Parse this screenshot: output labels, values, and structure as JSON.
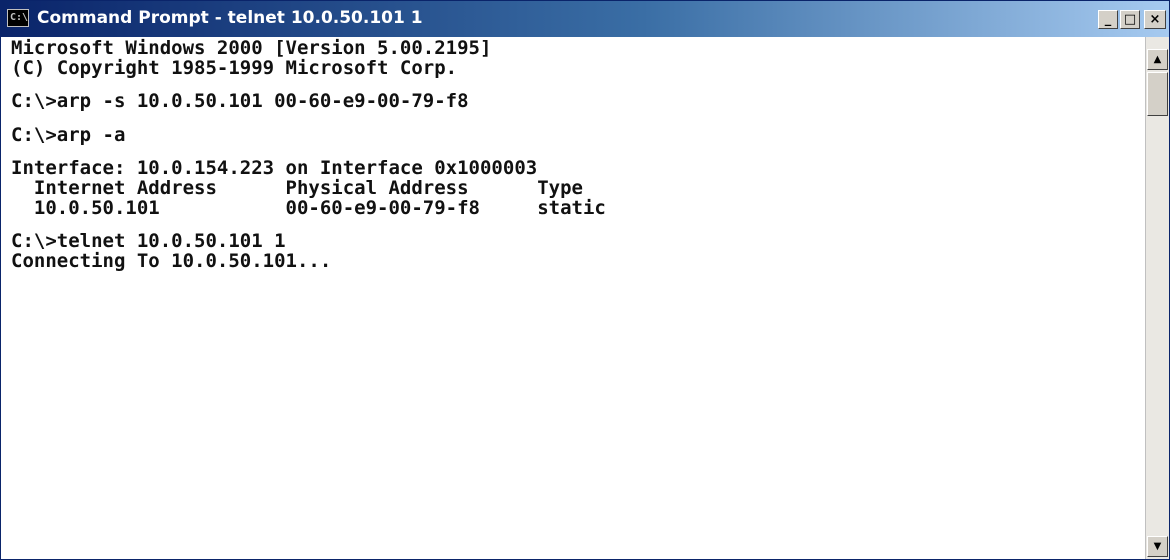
{
  "window": {
    "title": "Command Prompt - telnet 10.0.50.101 1",
    "icon": "console-app-icon",
    "icon_glyph": "C:\\",
    "controls": {
      "minimize": "_",
      "maximize": "□",
      "close": "×"
    }
  },
  "console": {
    "lines": [
      "Microsoft Windows 2000 [Version 5.00.2195]",
      "(C) Copyright 1985-1999 Microsoft Corp.",
      "",
      "C:\\>arp -s 10.0.50.101 00-60-e9-00-79-f8",
      "",
      "C:\\>arp -a",
      "",
      "Interface: 10.0.154.223 on Interface 0x1000003",
      "  Internet Address      Physical Address      Type",
      "  10.0.50.101           00-60-e9-00-79-f8     static",
      "",
      "C:\\>telnet 10.0.50.101 1",
      "Connecting To 10.0.50.101..."
    ]
  },
  "scrollbar": {
    "up_arrow": "▲",
    "down_arrow": "▼"
  }
}
